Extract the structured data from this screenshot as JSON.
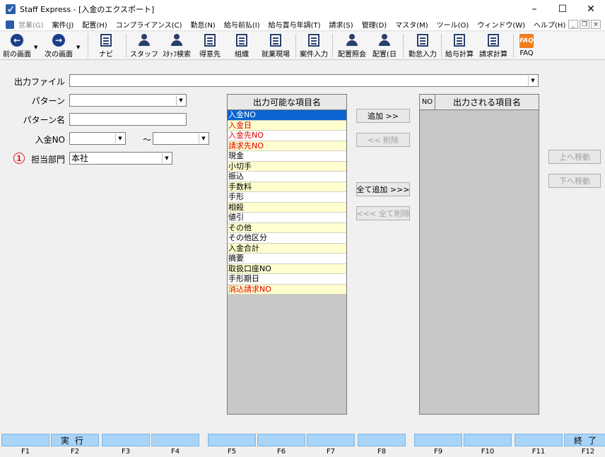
{
  "window": {
    "title": "Staff Express - [入金のエクスポート]",
    "minimize": "–",
    "maximize": "☐",
    "close": "✕"
  },
  "menu": {
    "items": [
      {
        "label": "営業(G)",
        "disabled": true
      },
      {
        "label": "案件(J)",
        "disabled": false
      },
      {
        "label": "配置(H)",
        "disabled": false
      },
      {
        "label": "コンプライアンス(C)",
        "disabled": false
      },
      {
        "label": "勤怠(N)",
        "disabled": false
      },
      {
        "label": "給与前払(I)",
        "disabled": false
      },
      {
        "label": "給与賞与年調(T)",
        "disabled": false
      },
      {
        "label": "請求(S)",
        "disabled": false
      },
      {
        "label": "管理(D)",
        "disabled": false
      },
      {
        "label": "マスタ(M)",
        "disabled": false
      },
      {
        "label": "ツール(O)",
        "disabled": false
      },
      {
        "label": "ウィンドウ(W)",
        "disabled": false
      },
      {
        "label": "ヘルプ(H)",
        "disabled": false
      }
    ],
    "mdi_min": "_",
    "mdi_restore": "❐",
    "mdi_close": "×"
  },
  "toolbar": {
    "back": "前の画面",
    "forward": "次の画面",
    "navi": "ナビ",
    "staff": "スタッフ",
    "staff_search": "ｽﾀｯﾌ検索",
    "client": "得意先",
    "org": "組織",
    "worksite": "就業現場",
    "case_input": "案件入力",
    "placement_inquiry": "配置照会",
    "placement_day": "配置(日",
    "attendance_input": "勤怠入力",
    "salary_calc": "給与計算",
    "billing_calc": "請求計算",
    "faq": "FAQ",
    "faq_icon_text": "FAQ"
  },
  "form": {
    "output_file_label": "出力ファイル",
    "output_file_value": "",
    "pattern_label": "パターン",
    "pattern_value": "",
    "pattern_name_label": "パターン名",
    "pattern_name_value": "",
    "deposit_no_label": "入金NO",
    "deposit_no_from": "",
    "tilde": "～",
    "deposit_no_to": "",
    "circled_number": "1",
    "department_label": "担当部門",
    "department_value": "本社"
  },
  "available_list": {
    "header": "出力可能な項目名",
    "items": [
      {
        "label": "入金NO",
        "red": false,
        "selected": true
      },
      {
        "label": "入金日",
        "red": true,
        "selected": false
      },
      {
        "label": "入金先NO",
        "red": true,
        "selected": false
      },
      {
        "label": "請求先NO",
        "red": true,
        "selected": false
      },
      {
        "label": "現金",
        "red": false,
        "selected": false
      },
      {
        "label": "小切手",
        "red": false,
        "selected": false
      },
      {
        "label": "振込",
        "red": false,
        "selected": false
      },
      {
        "label": "手数料",
        "red": false,
        "selected": false
      },
      {
        "label": "手形",
        "red": false,
        "selected": false
      },
      {
        "label": "相殺",
        "red": false,
        "selected": false
      },
      {
        "label": "値引",
        "red": false,
        "selected": false
      },
      {
        "label": "その他",
        "red": false,
        "selected": false
      },
      {
        "label": "その他区分",
        "red": false,
        "selected": false
      },
      {
        "label": "入金合計",
        "red": false,
        "selected": false
      },
      {
        "label": "摘要",
        "red": false,
        "selected": false
      },
      {
        "label": "取扱口座NO",
        "red": false,
        "selected": false
      },
      {
        "label": "手形期日",
        "red": false,
        "selected": false
      },
      {
        "label": "消込請求NO",
        "red": true,
        "selected": false
      }
    ]
  },
  "buttons": {
    "add": "追加 >>",
    "remove": "<< 削除",
    "add_all": "全て追加 >>>",
    "remove_all": "<<< 全て削除",
    "move_up": "上へ移動",
    "move_down": "下へ移動"
  },
  "output_list": {
    "no_header": "NO",
    "name_header": "出力される項目名"
  },
  "fkeys": [
    {
      "key": "F1",
      "label": ""
    },
    {
      "key": "F2",
      "label": "実行"
    },
    {
      "key": "F3",
      "label": ""
    },
    {
      "key": "F4",
      "label": ""
    },
    {
      "key": "F5",
      "label": ""
    },
    {
      "key": "F6",
      "label": ""
    },
    {
      "key": "F7",
      "label": ""
    },
    {
      "key": "F8",
      "label": ""
    },
    {
      "key": "F9",
      "label": ""
    },
    {
      "key": "F10",
      "label": ""
    },
    {
      "key": "F11",
      "label": ""
    },
    {
      "key": "F12",
      "label": "終了"
    }
  ]
}
